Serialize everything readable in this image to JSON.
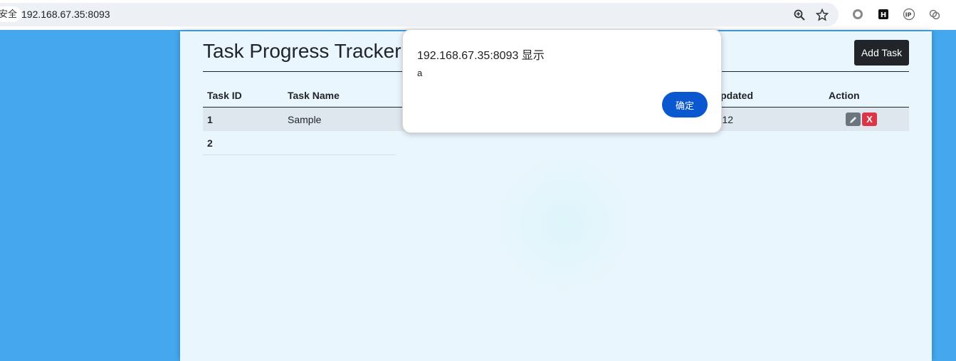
{
  "browser": {
    "secure_label": "安全",
    "url": "192.168.67.35:8093"
  },
  "page": {
    "title": "Task Progress Tracker",
    "add_button": "Add Task"
  },
  "table": {
    "columns": [
      "Task ID",
      "Task Name",
      "",
      "",
      "Updated",
      "Action"
    ],
    "rows": [
      {
        "id": "1",
        "name": "Sample",
        "updated": "7-12"
      },
      {
        "id": "2",
        "name": "",
        "updated": ""
      }
    ],
    "edit_icon": "pencil-icon",
    "delete_label": "X"
  },
  "dialog": {
    "title": "192.168.67.35:8093 显示",
    "message": "a",
    "ok_label": "确定"
  },
  "colors": {
    "background": "#45a8ee",
    "accent_button": "#0b57d0",
    "danger": "#dc3545",
    "dark_button": "#212529"
  }
}
